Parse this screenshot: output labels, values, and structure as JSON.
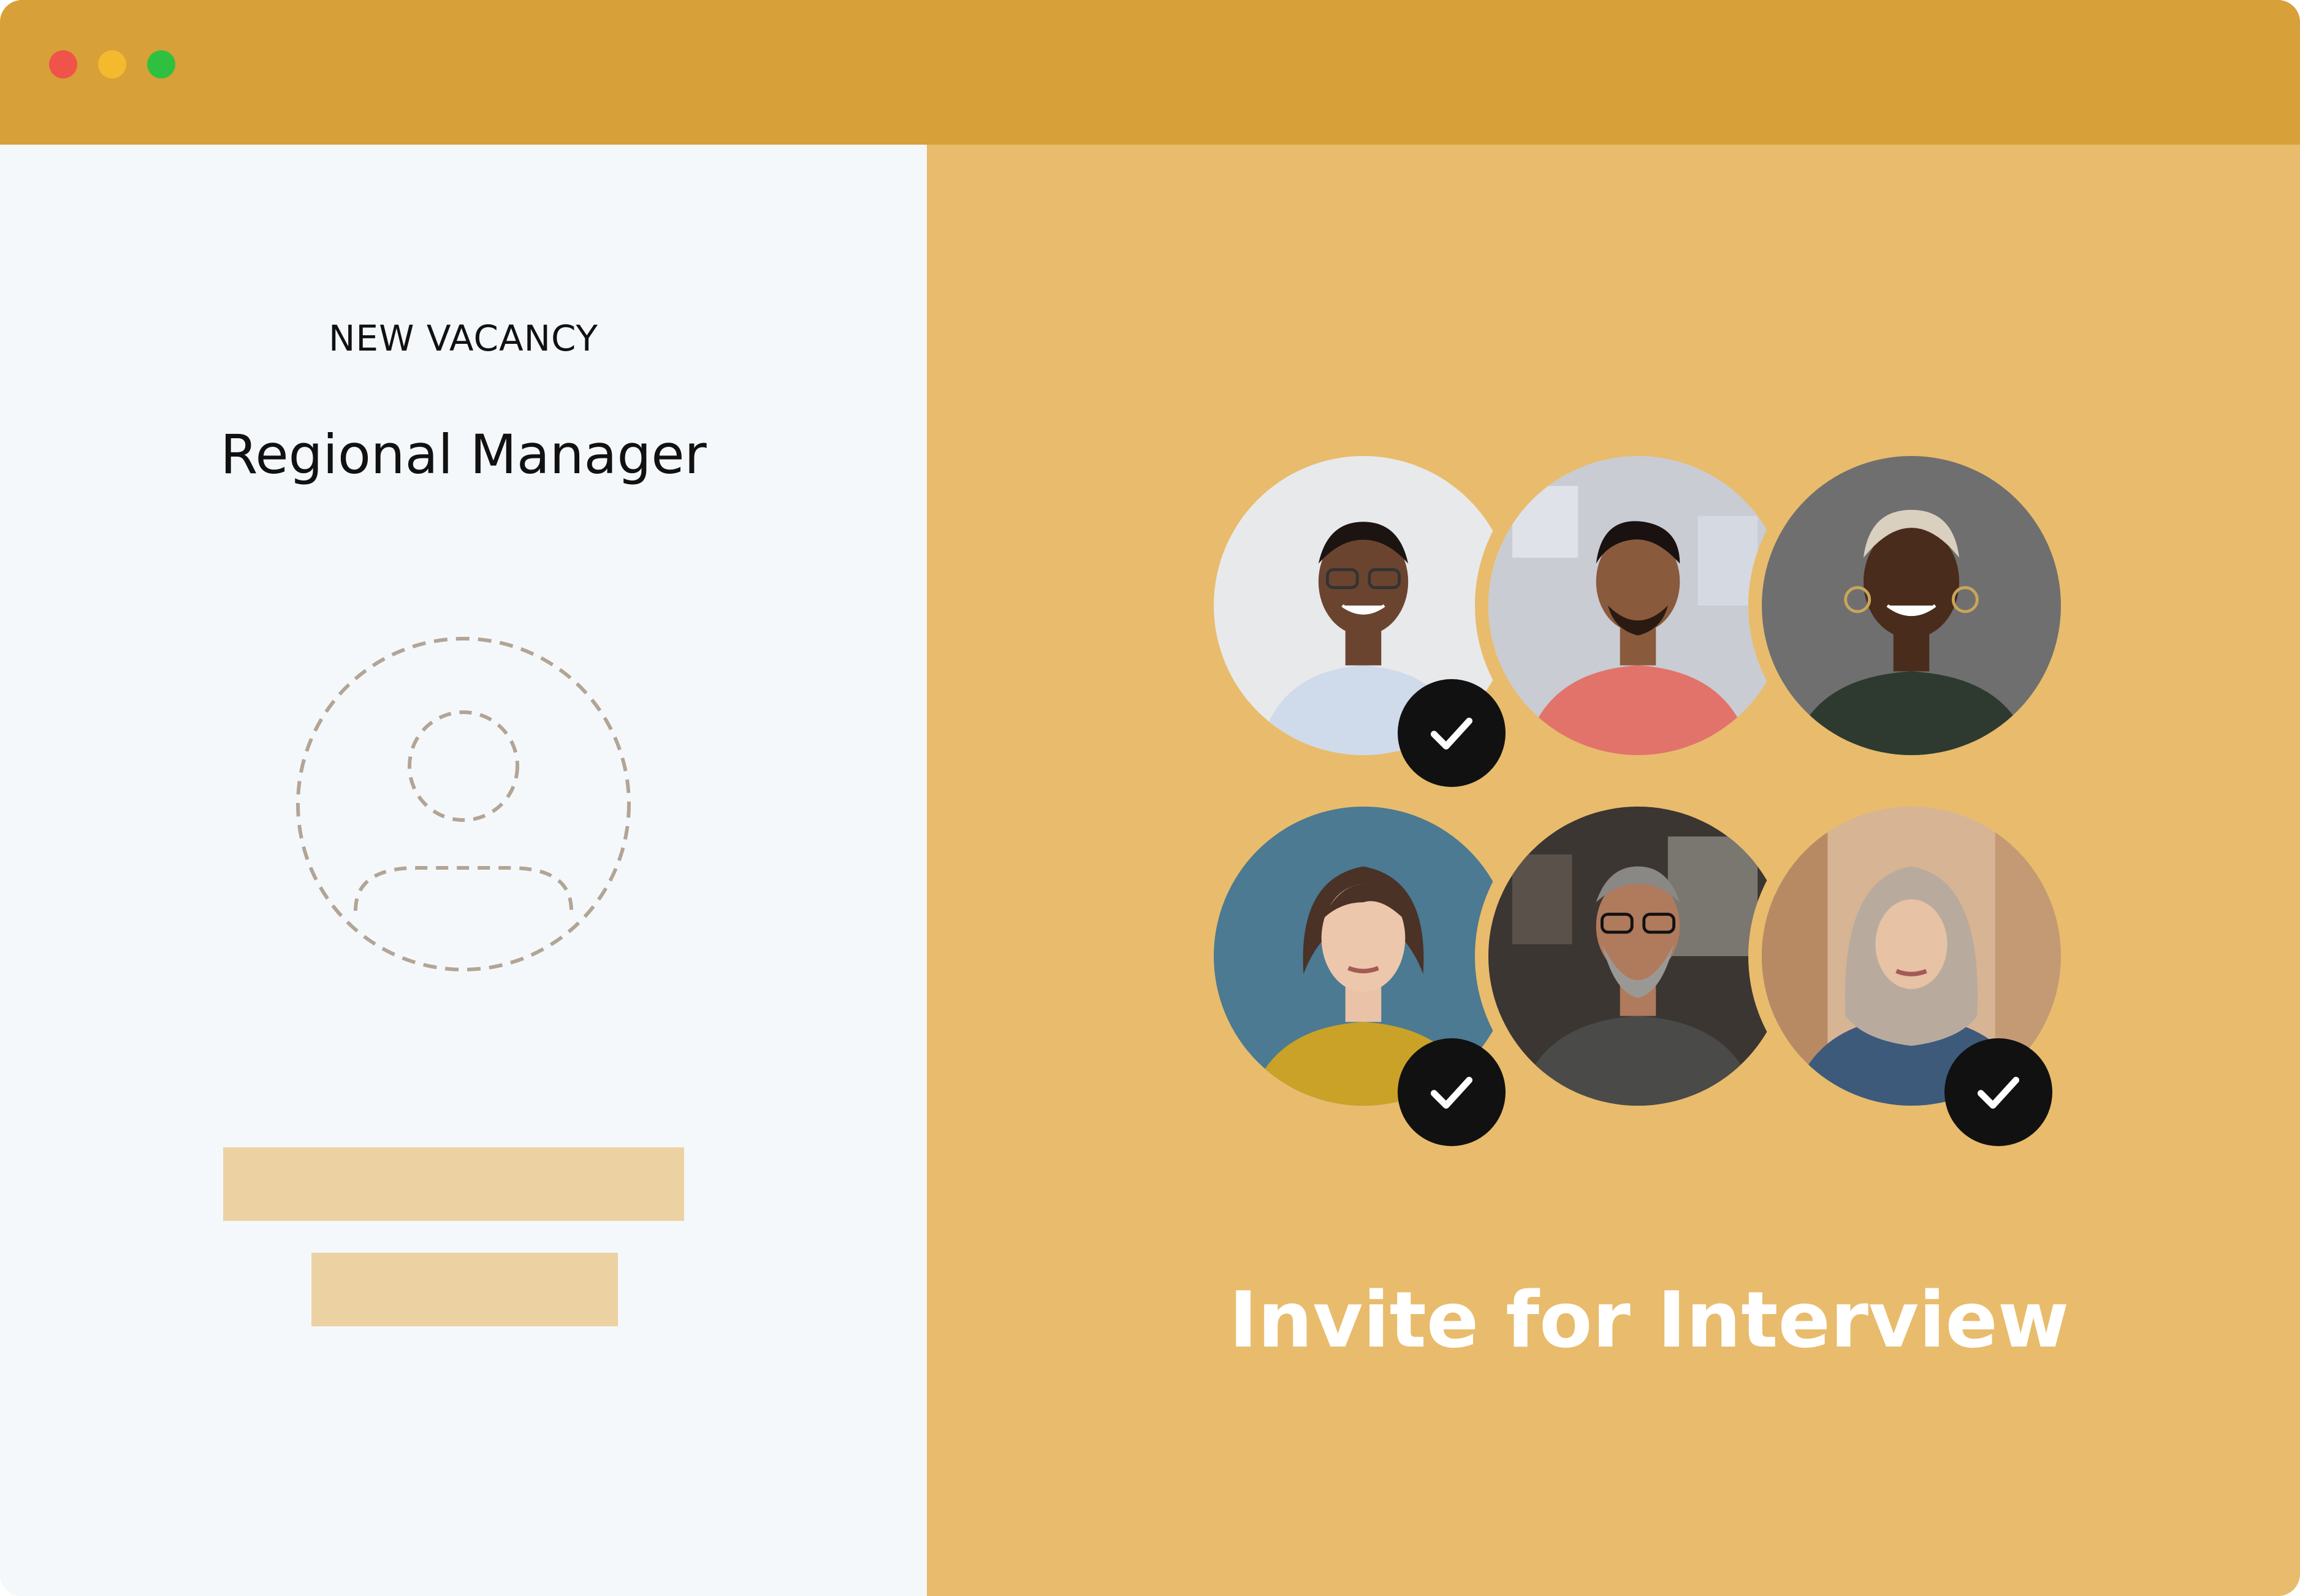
{
  "window": {
    "controls": [
      "close",
      "minimize",
      "maximize"
    ],
    "colors": {
      "titlebar": "#d8a038",
      "panel": "#e8bc6c",
      "left_bg": "#f5f8fb"
    }
  },
  "vacancy": {
    "eyebrow": "NEW VACANCY",
    "title": "Regional Manager",
    "placeholder_icon": "user-placeholder-icon"
  },
  "candidates": [
    {
      "photo_icon": "candidate-photo",
      "selected": true
    },
    {
      "photo_icon": "candidate-photo",
      "selected": false
    },
    {
      "photo_icon": "candidate-photo",
      "selected": false
    },
    {
      "photo_icon": "candidate-photo",
      "selected": true
    },
    {
      "photo_icon": "candidate-photo",
      "selected": false
    },
    {
      "photo_icon": "candidate-photo",
      "selected": true
    }
  ],
  "cta": {
    "label": "Invite for Interview"
  }
}
